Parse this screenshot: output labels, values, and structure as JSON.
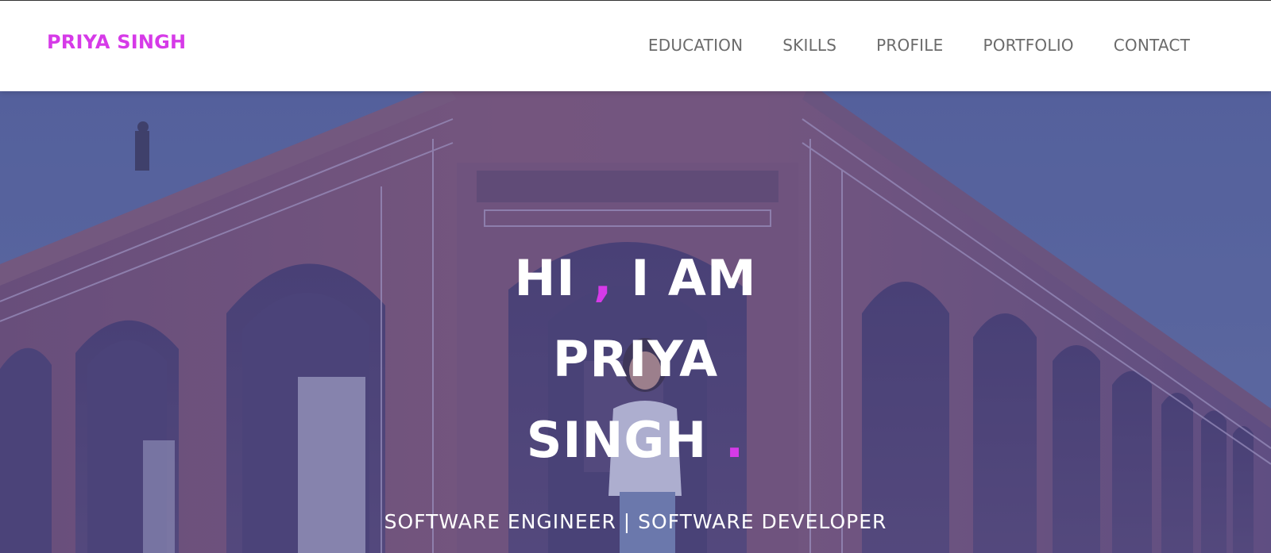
{
  "brand": {
    "name": "PRIYA SINGH",
    "color": "#d63ae8"
  },
  "nav": {
    "items": [
      {
        "label": "EDUCATION"
      },
      {
        "label": "SKILLS"
      },
      {
        "label": "PROFILE"
      },
      {
        "label": "PORTFOLIO"
      },
      {
        "label": "CONTACT"
      }
    ]
  },
  "hero": {
    "greeting": "HI",
    "comma": ",",
    "intro": "I AM",
    "first_name": "PRIYA",
    "last_name": "SINGH",
    "period": ".",
    "subtitle": "SOFTWARE ENGINEER | SOFTWARE DEVELOPER",
    "background_image": "historic-monument-photo",
    "accent_color": "#d63ae8"
  }
}
